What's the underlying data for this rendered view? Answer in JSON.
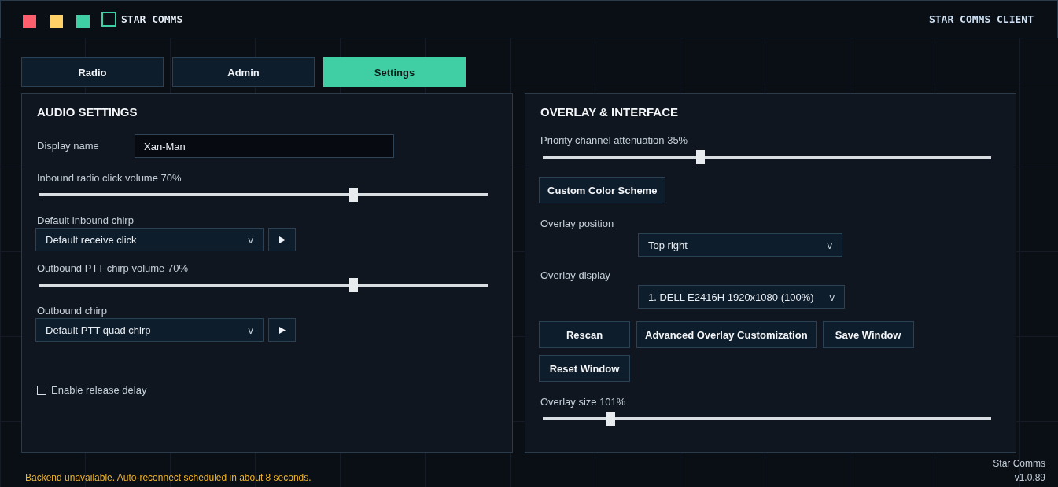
{
  "window": {
    "title": "STAR COMMS",
    "subtitle": "STAR COMMS CLIENT"
  },
  "tabs": [
    {
      "label": "Radio",
      "selected": false
    },
    {
      "label": "Admin",
      "selected": false
    },
    {
      "label": "Settings",
      "selected": true
    }
  ],
  "panels": [
    {
      "title": "AUDIO SETTINGS",
      "items": [
        {
          "kind": "text_field",
          "label": "Display name",
          "value": "Xan-Man"
        },
        {
          "kind": "slider",
          "label": "Inbound radio click volume 70%",
          "level": 0.7
        },
        {
          "kind": "select",
          "label": "Default inbound chirp",
          "value": "Default receive click",
          "caret": "v"
        },
        {
          "kind": "slider",
          "label": "Outbound PTT chirp volume 70%",
          "level": 0.7
        },
        {
          "kind": "select",
          "label": "Outbound chirp",
          "value": "Default PTT quad chirp",
          "caret": "v"
        },
        {
          "kind": "checkbox",
          "label": "Enable release delay",
          "checked": false
        }
      ]
    },
    {
      "title": "OVERLAY & INTERFACE",
      "items": [
        {
          "kind": "slider",
          "label": "Priority channel attenuation 35%",
          "level": 0.35
        },
        {
          "kind": "buttons",
          "labels": [
            "Custom Color Scheme"
          ]
        },
        {
          "kind": "picker",
          "label": "Overlay position",
          "value": "Top right",
          "caret": "v"
        },
        {
          "kind": "picker",
          "label": "Overlay display",
          "value": "1. DELL E2416H 1920x1080 (100%)",
          "caret": "v"
        },
        {
          "kind": "buttons",
          "labels": [
            "Rescan",
            "Advanced Overlay Customization",
            "Save Window",
            "Reset Window"
          ]
        },
        {
          "kind": "slider",
          "label": "Overlay size 101%",
          "level": 0.15
        }
      ]
    }
  ],
  "status_bar": {
    "message": "Backend unavailable. Auto-reconnect scheduled in about 8 seconds.",
    "app_name": "Star Comms",
    "version": "v1.0.89"
  }
}
